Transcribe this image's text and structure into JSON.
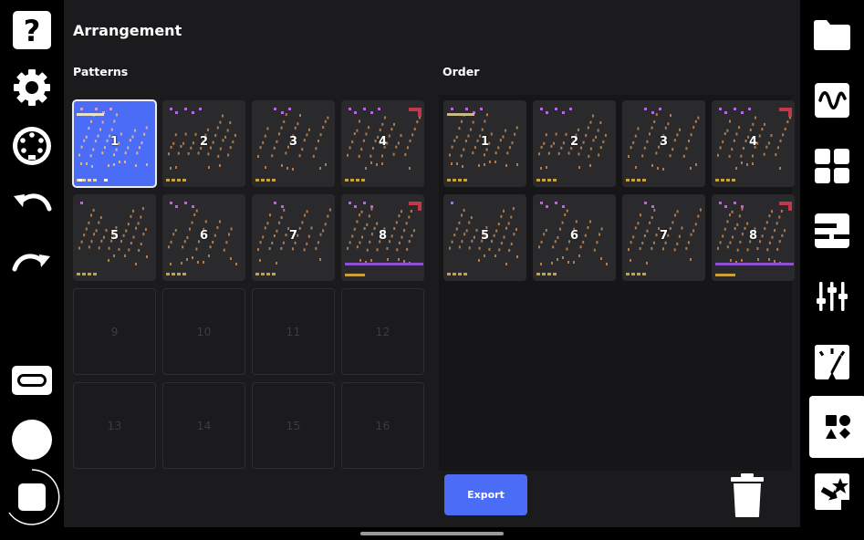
{
  "header": {
    "title": "Arrangement"
  },
  "sections": {
    "patterns_label": "Patterns",
    "order_label": "Order"
  },
  "patterns": [
    {
      "label": "1"
    },
    {
      "label": "2"
    },
    {
      "label": "3"
    },
    {
      "label": "4"
    },
    {
      "label": "5"
    },
    {
      "label": "6"
    },
    {
      "label": "7"
    },
    {
      "label": "8"
    },
    {
      "label": "9"
    },
    {
      "label": "10"
    },
    {
      "label": "11"
    },
    {
      "label": "12"
    },
    {
      "label": "13"
    },
    {
      "label": "14"
    },
    {
      "label": "15"
    },
    {
      "label": "16"
    }
  ],
  "order": [
    {
      "label": "1"
    },
    {
      "label": "2"
    },
    {
      "label": "3"
    },
    {
      "label": "4"
    },
    {
      "label": "5"
    },
    {
      "label": "6"
    },
    {
      "label": "7"
    },
    {
      "label": "8"
    }
  ],
  "footer": {
    "export_label": "Export"
  },
  "left_rail": [
    "help-icon",
    "settings-gear-icon",
    "midi-icon",
    "undo-icon",
    "redo-icon",
    "cassette-icon",
    "record-icon",
    "stop-icon"
  ],
  "right_rail": [
    "folder-icon",
    "wave-icon",
    "grid-icon",
    "piano-roll-icon",
    "mixer-icon",
    "meter-icon",
    "arrangement-shapes-icon",
    "export-star-icon"
  ],
  "colors": {
    "accent": "#4a6cf7",
    "panel": "#1b1b1d",
    "cell": "#2a2a2d",
    "note_orange": "#b07a4a",
    "note_purple": "#b36ad6",
    "note_red": "#c0394b",
    "bar_yellow": "#c9a13a",
    "bar_purple": "#8e4fd0"
  }
}
